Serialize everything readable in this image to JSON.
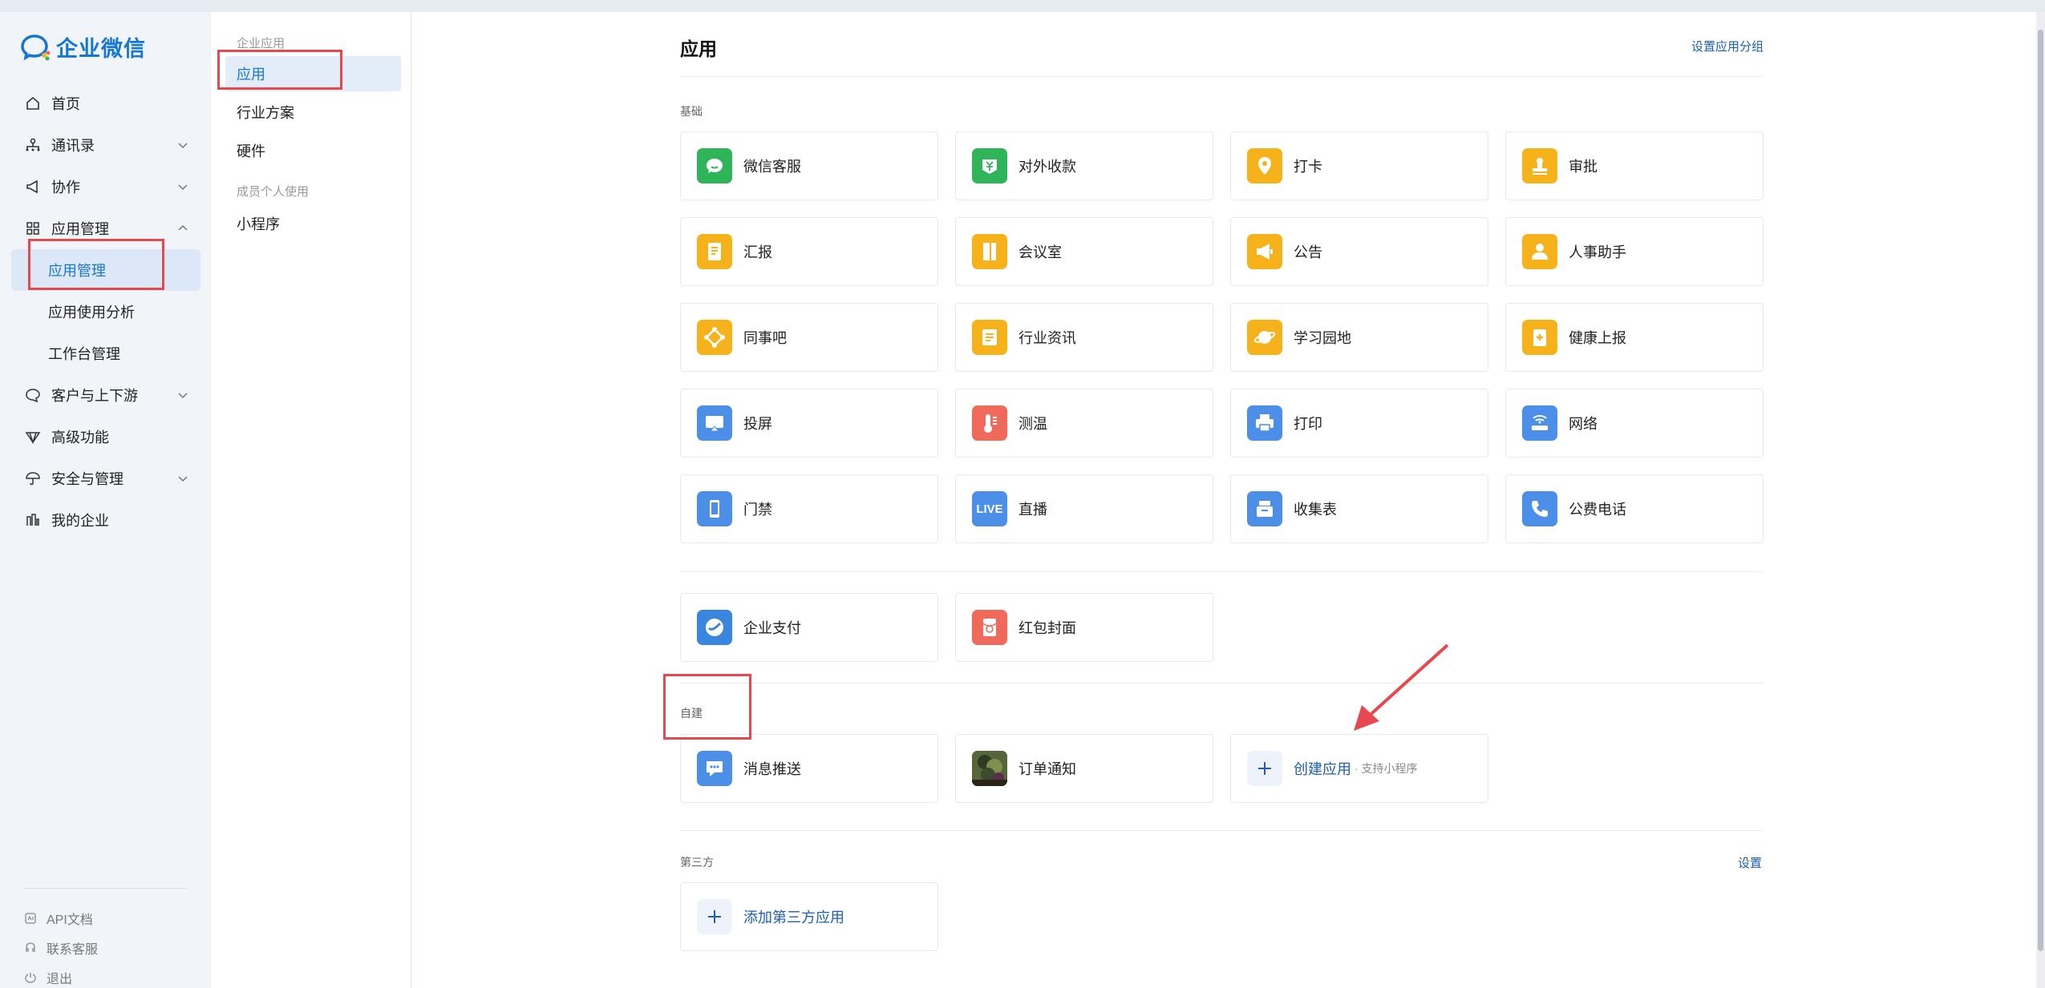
{
  "brand": {
    "name": "企业微信"
  },
  "sidebar": {
    "items": [
      {
        "label": "首页",
        "icon": "home-icon"
      },
      {
        "label": "通讯录",
        "icon": "org-icon",
        "expandable": true
      },
      {
        "label": "协作",
        "icon": "megaphone-icon",
        "expandable": true
      },
      {
        "label": "应用管理",
        "icon": "apps-grid-icon",
        "expanded": true
      },
      {
        "label": "应用管理",
        "sub": true,
        "active": true
      },
      {
        "label": "应用使用分析",
        "sub": true
      },
      {
        "label": "工作台管理",
        "sub": true
      },
      {
        "label": "客户与上下游",
        "icon": "chat-bubble-icon",
        "expandable": true
      },
      {
        "label": "高级功能",
        "icon": "diamond-icon"
      },
      {
        "label": "安全与管理",
        "icon": "umbrella-icon",
        "expandable": true
      },
      {
        "label": "我的企业",
        "icon": "building-icon"
      }
    ],
    "bottom": [
      {
        "label": "API文档",
        "icon": "api-doc-icon"
      },
      {
        "label": "联系客服",
        "icon": "headset-icon"
      },
      {
        "label": "退出",
        "icon": "power-icon"
      }
    ]
  },
  "subnav": {
    "group1": "企业应用",
    "items1": [
      "应用",
      "行业方案",
      "硬件"
    ],
    "group2": "成员个人使用",
    "items2": [
      "小程序"
    ]
  },
  "main": {
    "title": "应用",
    "set_group_link": "设置应用分组",
    "basic_label": "基础",
    "basic_apps": [
      {
        "label": "微信客服",
        "icon": "wechat-service-icon",
        "color": "#2fb45a"
      },
      {
        "label": "对外收款",
        "icon": "yuan-wallet-icon",
        "color": "#2fb45a"
      },
      {
        "label": "打卡",
        "icon": "location-pin-icon",
        "color": "#f6b21b"
      },
      {
        "label": "审批",
        "icon": "stamp-icon",
        "color": "#f6b21b"
      },
      {
        "label": "汇报",
        "icon": "report-icon",
        "color": "#f6b21b"
      },
      {
        "label": "会议室",
        "icon": "door-icon",
        "color": "#f6b21b"
      },
      {
        "label": "公告",
        "icon": "announcement-icon",
        "color": "#f6b21b"
      },
      {
        "label": "人事助手",
        "icon": "person-icon",
        "color": "#f6b21b"
      },
      {
        "label": "同事吧",
        "icon": "network-icon",
        "color": "#f6b21b"
      },
      {
        "label": "行业资讯",
        "icon": "news-icon",
        "color": "#f6b21b"
      },
      {
        "label": "学习园地",
        "icon": "planet-icon",
        "color": "#f6b21b"
      },
      {
        "label": "健康上报",
        "icon": "health-clipboard-icon",
        "color": "#f6b21b"
      },
      {
        "label": "投屏",
        "icon": "screencast-icon",
        "color": "#4b8fe8"
      },
      {
        "label": "测温",
        "icon": "thermometer-icon",
        "color": "#ef6a5b"
      },
      {
        "label": "打印",
        "icon": "printer-icon",
        "color": "#4b8fe8"
      },
      {
        "label": "网络",
        "icon": "wifi-router-icon",
        "color": "#4b8fe8"
      },
      {
        "label": "门禁",
        "icon": "phone-device-icon",
        "color": "#4b8fe8"
      },
      {
        "label": "直播",
        "icon": "live-icon",
        "color": "#4b8fe8",
        "text": "LIVE"
      },
      {
        "label": "收集表",
        "icon": "form-box-icon",
        "color": "#4b8fe8"
      },
      {
        "label": "公费电话",
        "icon": "phone-icon",
        "color": "#4b8fe8"
      }
    ],
    "pay_apps": [
      {
        "label": "企业支付",
        "icon": "pay-icon",
        "color": "#3a86de"
      },
      {
        "label": "红包封面",
        "icon": "red-envelope-icon",
        "color": "#ef6a5b"
      }
    ],
    "custom_label": "自建",
    "custom_apps": [
      {
        "label": "消息推送",
        "icon": "message-push-icon",
        "color": "#4b8fe8"
      },
      {
        "label": "订单通知",
        "icon": "photo-thumbnail-icon",
        "color": "#3b4a2c"
      }
    ],
    "create_app": {
      "label": "创建应用",
      "sub": "· 支持小程序",
      "icon": "plus-icon"
    },
    "third_label": "第三方",
    "settings_link": "设置",
    "add_third": {
      "label": "添加第三方应用",
      "icon": "plus-icon"
    }
  }
}
